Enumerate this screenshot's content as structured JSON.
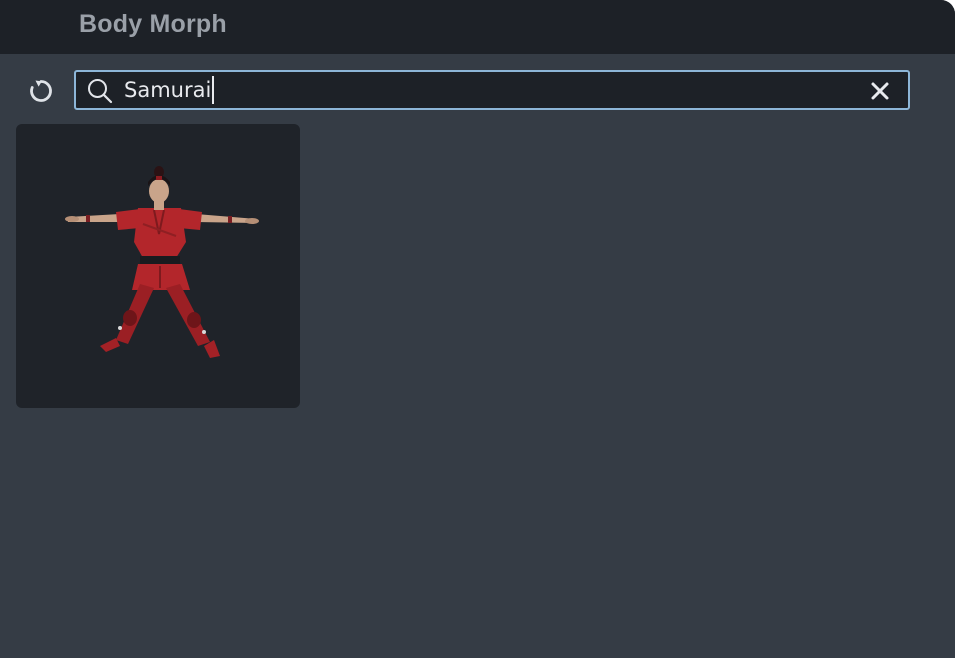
{
  "window": {
    "title": "Body Morph"
  },
  "toolbar": {
    "refresh_icon": "refresh-icon",
    "search": {
      "value": "Samurai",
      "search_icon": "search-icon",
      "clear_icon": "close-icon"
    }
  },
  "results": [
    {
      "thumbnail": "samurai-t-pose-figure"
    }
  ],
  "colors": {
    "window_bg": "#353c45",
    "titlebar_bg": "#1d2127",
    "title_text": "#9aa0a8",
    "search_border": "#8db6d8",
    "card_bg": "#1f2329",
    "outfit_red": "#b3262b"
  }
}
